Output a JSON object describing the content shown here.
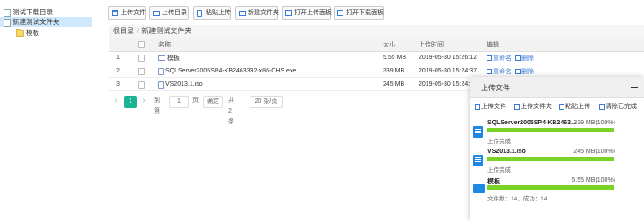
{
  "sidebar": {
    "items": [
      {
        "label": "测试下载目录"
      },
      {
        "label": "新建测试文件夹"
      },
      {
        "label": "模板"
      }
    ]
  },
  "toolbar": {
    "upload_file": "上传文件",
    "upload_dir": "上传目录",
    "paste_upload": "粘贴上传",
    "new_folder": "新建文件夹",
    "open_upload_panel": "打开上传面板",
    "open_download_panel": "打开下载面板"
  },
  "breadcrumb": {
    "root": "根目录",
    "separator": "/",
    "current": "新建测试文件夹"
  },
  "table": {
    "headers": {
      "name": "名称",
      "size": "大小",
      "time": "上传时间",
      "edit": "编辑"
    },
    "rows": [
      {
        "num": "1",
        "name": "模板",
        "type": "folder",
        "size": "5.55 MB",
        "time": "2019-05-30 15:26:12",
        "rename": "重命名",
        "delete": "删除"
      },
      {
        "num": "2",
        "name": "SQLServer2005SP4-KB2463332-x86-CHS.exe",
        "type": "file",
        "size": "339 MB",
        "time": "2019-05-30 15:24:37",
        "rename": "重命名",
        "delete": "删除"
      },
      {
        "num": "3",
        "name": "VS2013.1.iso",
        "type": "file",
        "size": "245 MB",
        "time": "2019-05-30 15:24:35",
        "rename": "",
        "delete": ""
      }
    ]
  },
  "pager": {
    "prev": "‹",
    "current": "1",
    "next": "›",
    "goto": "到第",
    "page_input": "1",
    "page_unit": "页",
    "confirm": "确定",
    "total": "共 2 条",
    "per_page": "20 条/页"
  },
  "upload_panel": {
    "title": "上传文件",
    "actions": {
      "upload_file": "上传文件",
      "upload_dir": "上传文件夹",
      "paste_upload": "粘贴上传",
      "clear_done": "清除已完成"
    },
    "items": [
      {
        "name": "SQLServer2005SP4-KB2463...",
        "size": "339 MB(100%)",
        "progress": 1.0,
        "status": "上传完成",
        "type": "file"
      },
      {
        "name": "VS2013.1.iso",
        "size": "245 MB(100%)",
        "progress": 1.0,
        "status": "上传完成",
        "type": "file"
      },
      {
        "name": "模板",
        "size": "5.55 MB(100%)",
        "progress": 1.0,
        "status": "文件数：14，成功：14",
        "type": "folder"
      }
    ]
  },
  "colors": {
    "accent": "#1ab394",
    "progress": "#7cd327",
    "link": "#3a7bd5",
    "selected": "#cfe8fb"
  }
}
